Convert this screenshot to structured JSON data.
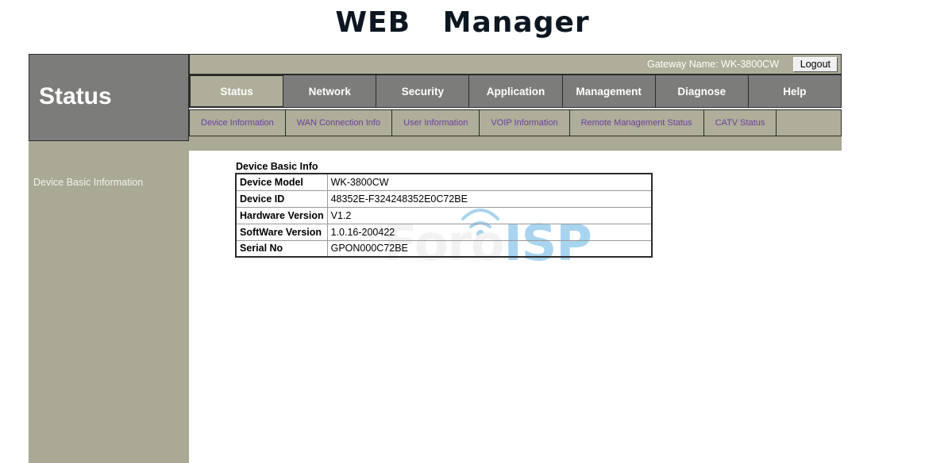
{
  "page": {
    "title": "WEB   Manager"
  },
  "sidebar": {
    "header_label": "Status",
    "items": [
      {
        "label": "Device Basic Information"
      }
    ]
  },
  "topbar": {
    "gateway_label": "Gateway Name: WK-3800CW",
    "logout_label": "Logout"
  },
  "mainnav": {
    "tabs": [
      {
        "label": "Status",
        "active": true
      },
      {
        "label": "Network",
        "active": false
      },
      {
        "label": "Security",
        "active": false
      },
      {
        "label": "Application",
        "active": false
      },
      {
        "label": "Management",
        "active": false
      },
      {
        "label": "Diagnose",
        "active": false
      },
      {
        "label": "Help",
        "active": false
      }
    ]
  },
  "subnav": {
    "items": [
      {
        "label": "Device Information"
      },
      {
        "label": "WAN Connection Info"
      },
      {
        "label": "User Information"
      },
      {
        "label": "VOIP Information"
      },
      {
        "label": "Remote Management Status"
      },
      {
        "label": "CATV Status"
      }
    ]
  },
  "content": {
    "section_title": "Device Basic Info",
    "table": {
      "rows": [
        {
          "key": "Device Model",
          "value": "WK-3800CW"
        },
        {
          "key": "Device ID",
          "value": "48352E-F324248352E0C72BE"
        },
        {
          "key": "Hardware Version",
          "value": "V1.2"
        },
        {
          "key": "SoftWare Version",
          "value": "1.0.16-200422"
        },
        {
          "key": "Serial No",
          "value": "GPON000C72BE"
        }
      ]
    },
    "watermark": {
      "text_primary": "Foro",
      "text_secondary": "ISP"
    }
  },
  "colors": {
    "khaki": "#a9a995",
    "khaki_light": "#aeae9a",
    "gray": "#7c7c7a",
    "border_dark": "#2b2b2b",
    "subnav_text": "#6b3fa0",
    "watermark_blue": "#a8d4ef"
  }
}
